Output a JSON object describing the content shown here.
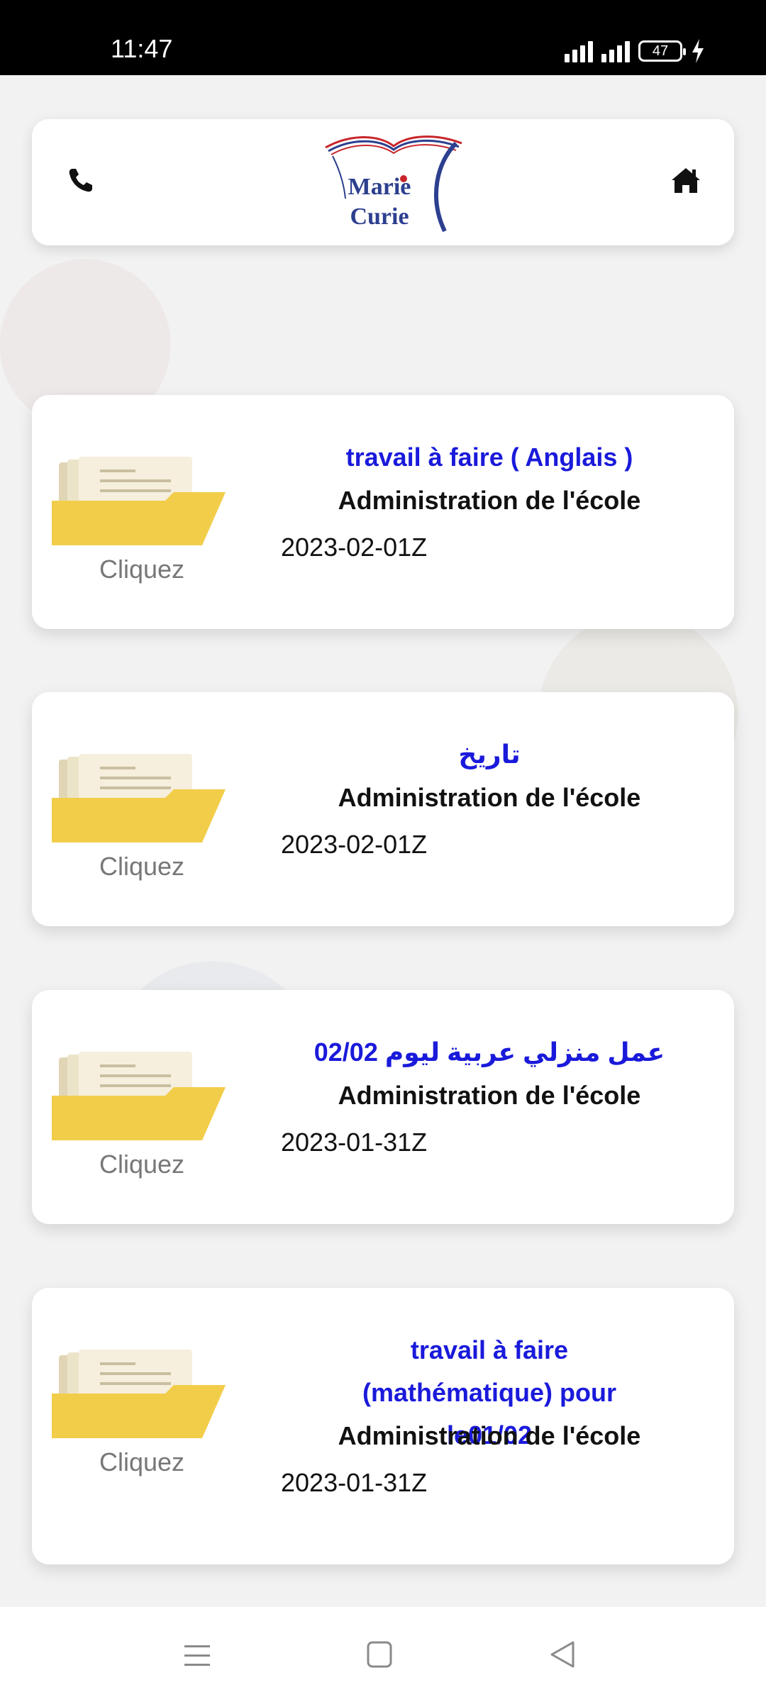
{
  "status": {
    "time": "11:47",
    "battery": "47"
  },
  "header": {
    "logo_line1": "Marie",
    "logo_line2": "Curie"
  },
  "items": [
    {
      "title": "travail à faire ( Anglais )",
      "author": "Administration de l'école",
      "date": "2023-02-01Z",
      "action": "Cliquez"
    },
    {
      "title": "تاريخ",
      "author": "Administration de l'école",
      "date": "2023-02-01Z",
      "action": "Cliquez"
    },
    {
      "title": "عمل منزلي عربية ليوم 02/02",
      "author": "Administration de l'école",
      "date": "2023-01-31Z",
      "action": "Cliquez"
    },
    {
      "title": "travail à faire (mathématique) pour le01/02",
      "author": "Administration de l'école",
      "date": "2023-01-31Z",
      "action": "Cliquez"
    }
  ],
  "colors": {
    "title_blue": "#1a1adb",
    "folder_yellow": "#f2cd4a",
    "logo_blue": "#2d3f8f"
  }
}
